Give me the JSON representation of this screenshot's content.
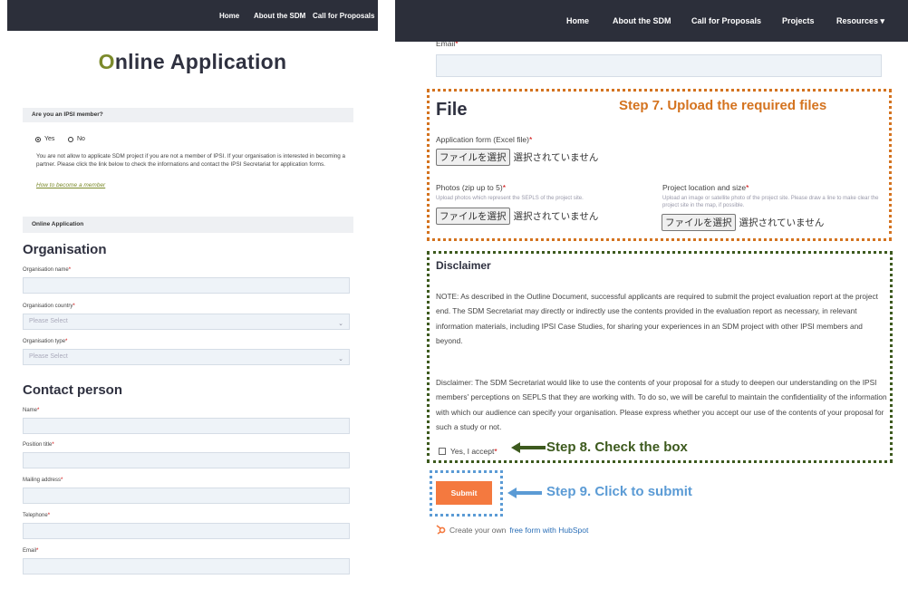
{
  "left": {
    "nav": [
      "Home",
      "About the SDM",
      "Call for Proposals"
    ],
    "title_first": "O",
    "title_rest": "nline Application",
    "ipsi_section": "Are you an IPSI member?",
    "radio_yes": "Yes",
    "radio_no": "No",
    "notice": "You are not allow to applicate SDM project if you are not a member of IPSI. If your organisation is interested in becoming a partner. Please click the link below to check the informations and contact the IPSI Secretariat for application forms.",
    "become_member_link": "How to become a member",
    "online_section": "Online Application",
    "org_heading": "Organisation",
    "org_name_label": "Organisation name",
    "org_country_label": "Organisation country",
    "org_country_placeholder": "Please Select",
    "org_type_label": "Organisation type",
    "org_type_placeholder": "Please Select",
    "contact_heading": "Contact person",
    "name_label": "Name",
    "position_label": "Position title",
    "mailing_label": "Mailing address",
    "telephone_label": "Telephone",
    "email_label": "Email",
    "required_mark": "*"
  },
  "right": {
    "nav": [
      "Home",
      "About the SDM",
      "Call for Proposals",
      "Projects",
      "Resources ▾"
    ],
    "email_label": "Email",
    "file_heading": "File",
    "step7": "Step 7. Upload the required files",
    "app_form_label": "Application form (Excel file)",
    "choose_file": "ファイルを選択",
    "no_file": "選択されていません",
    "photos_label": "Photos (zip up to 5)",
    "photos_hint": "Upload photos which represent the SEPLS of the project site.",
    "location_label": "Project location and size",
    "location_hint": "Upload an image or satellite photo of the project site. Please draw a line to make clear the project site in the map, if possible.",
    "disclaimer_heading": "Disclaimer",
    "note_text": "NOTE: As described in the Outline Document, successful applicants are required to submit the project evaluation report at the project end. The SDM Secretariat may directly or indirectly use the contents provided in the evaluation report as necessary, in relevant information materials, including IPSI Case Studies, for sharing your experiences in an SDM project with other IPSI members and beyond.",
    "disclaimer_text": "Disclaimer: The SDM Secretariat would like to use the contents of your proposal for a study to deepen our understanding on the IPSI members' perceptions on SEPLS that they are working with. To do so, we will be careful to maintain the confidentiality of the information with which our audience can specify your organisation. Please express whether you accept our use of the contents of your proposal for such a study or not.",
    "accept_label": "Yes, I accept",
    "step8": "Step 8. Check the box",
    "submit_label": "Submit",
    "step9": "Step 9. Click to submit",
    "hubspot_prefix": "Create your own",
    "hubspot_link": "free form with HubSpot",
    "required_mark": "*"
  },
  "colors": {
    "nav_bg": "#2c2f3a",
    "step7": "#d4731f",
    "step8": "#3d5a1e",
    "step9": "#5b9bd5",
    "submit": "#f4793f",
    "accent_green": "#7b8a2b"
  },
  "icons": [
    "arrow-left-icon",
    "hubspot-icon",
    "chevron-down-icon"
  ]
}
